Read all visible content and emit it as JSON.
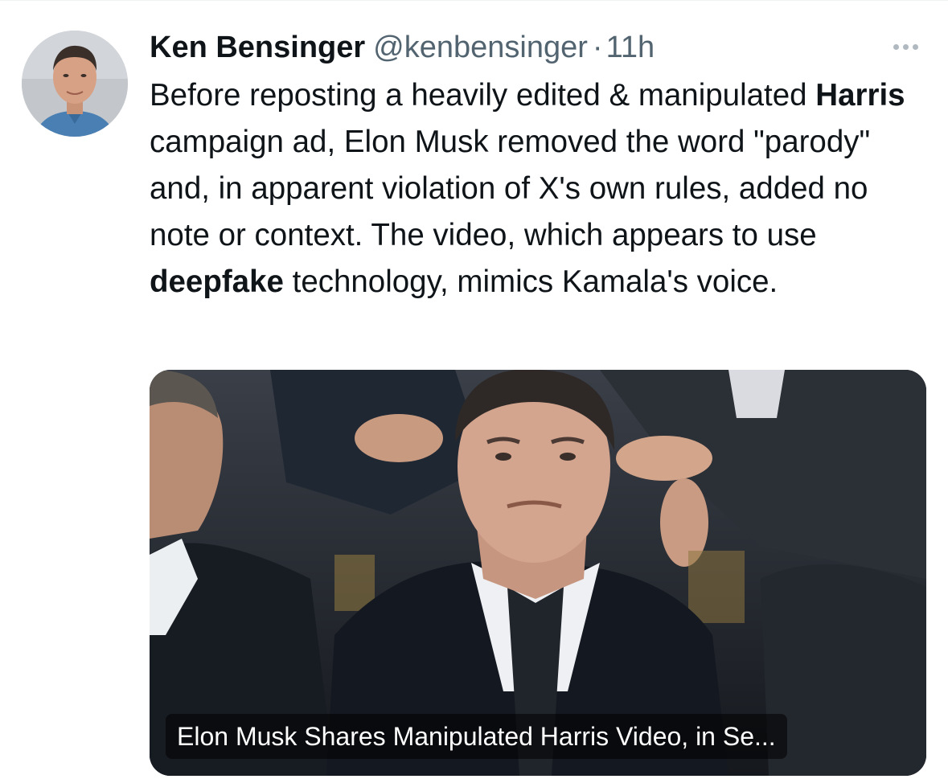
{
  "tweet": {
    "author_name": "Ken Bensinger",
    "author_handle": "@kenbensinger",
    "separator": "·",
    "timestamp": "11h",
    "text": [
      {
        "text": "Before reposting a heavily edited & manipulated ",
        "bold": false
      },
      {
        "text": "Harris",
        "bold": true
      },
      {
        "text": " campaign ad, Elon Musk removed the word \"parody\" and, in apparent violation of X's own rules, added no note or context. The video, which appears to use ",
        "bold": false
      },
      {
        "text": "deepfake",
        "bold": true
      },
      {
        "text": " technology, mimics Kamala's voice.",
        "bold": false
      }
    ],
    "link_card": {
      "title": "Elon Musk Shares Manipulated Harris Video, in Se..."
    }
  },
  "icons": {
    "more": "more-horizontal-icon",
    "avatar": "profile-photo"
  },
  "colors": {
    "text_primary": "#0f1419",
    "text_secondary": "#536471",
    "more_dots": "#b0b9c0"
  }
}
